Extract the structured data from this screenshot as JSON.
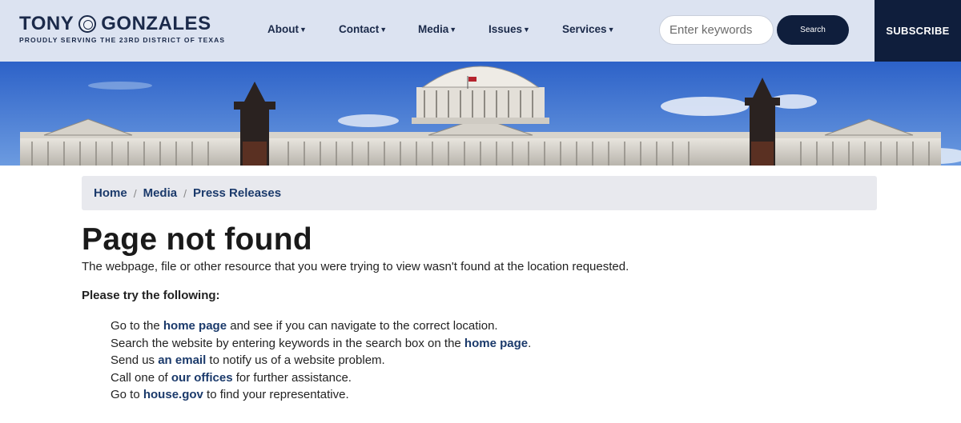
{
  "header": {
    "logo": {
      "name_left": "TONY",
      "name_right": "GONZALES",
      "tagline": "PROUDLY SERVING THE 23RD DISTRICT OF TEXAS"
    },
    "nav": [
      {
        "label": "About",
        "caret": "▼"
      },
      {
        "label": "Contact",
        "caret": "▼"
      },
      {
        "label": "Media",
        "caret": "▼"
      },
      {
        "label": "Issues",
        "caret": "▼"
      },
      {
        "label": "Services",
        "caret": "▼"
      }
    ],
    "search": {
      "placeholder": "Enter keywords",
      "button_label": "Search"
    },
    "subscribe_label": "SUBSCRIBE"
  },
  "breadcrumb": [
    {
      "label": "Home"
    },
    {
      "label": "Media"
    },
    {
      "label": "Press Releases"
    }
  ],
  "breadcrumb_separator": "/",
  "main": {
    "title": "Page not found",
    "intro": "The webpage, file or other resource that you were trying to view wasn't found at the location requested.",
    "try_heading": "Please try the following:",
    "suggestions": [
      {
        "before": "Go to the ",
        "link": "home page",
        "after": " and see if you can navigate to the correct location."
      },
      {
        "before": "Search the website by entering keywords in the search box on the ",
        "link": "home page",
        "after": "."
      },
      {
        "before": "Send us ",
        "link": "an email",
        "after": " to notify us of a website problem."
      },
      {
        "before": "Call one of ",
        "link": "our offices",
        "after": " for further assistance."
      },
      {
        "before": "Go to ",
        "link": "house.gov",
        "after": " to find your representative."
      }
    ]
  },
  "colors": {
    "header_bg": "#dce3f1",
    "navy": "#0f1e3c",
    "link": "#1b3a6b",
    "breadcrumb_bg": "#e8e9ee"
  }
}
